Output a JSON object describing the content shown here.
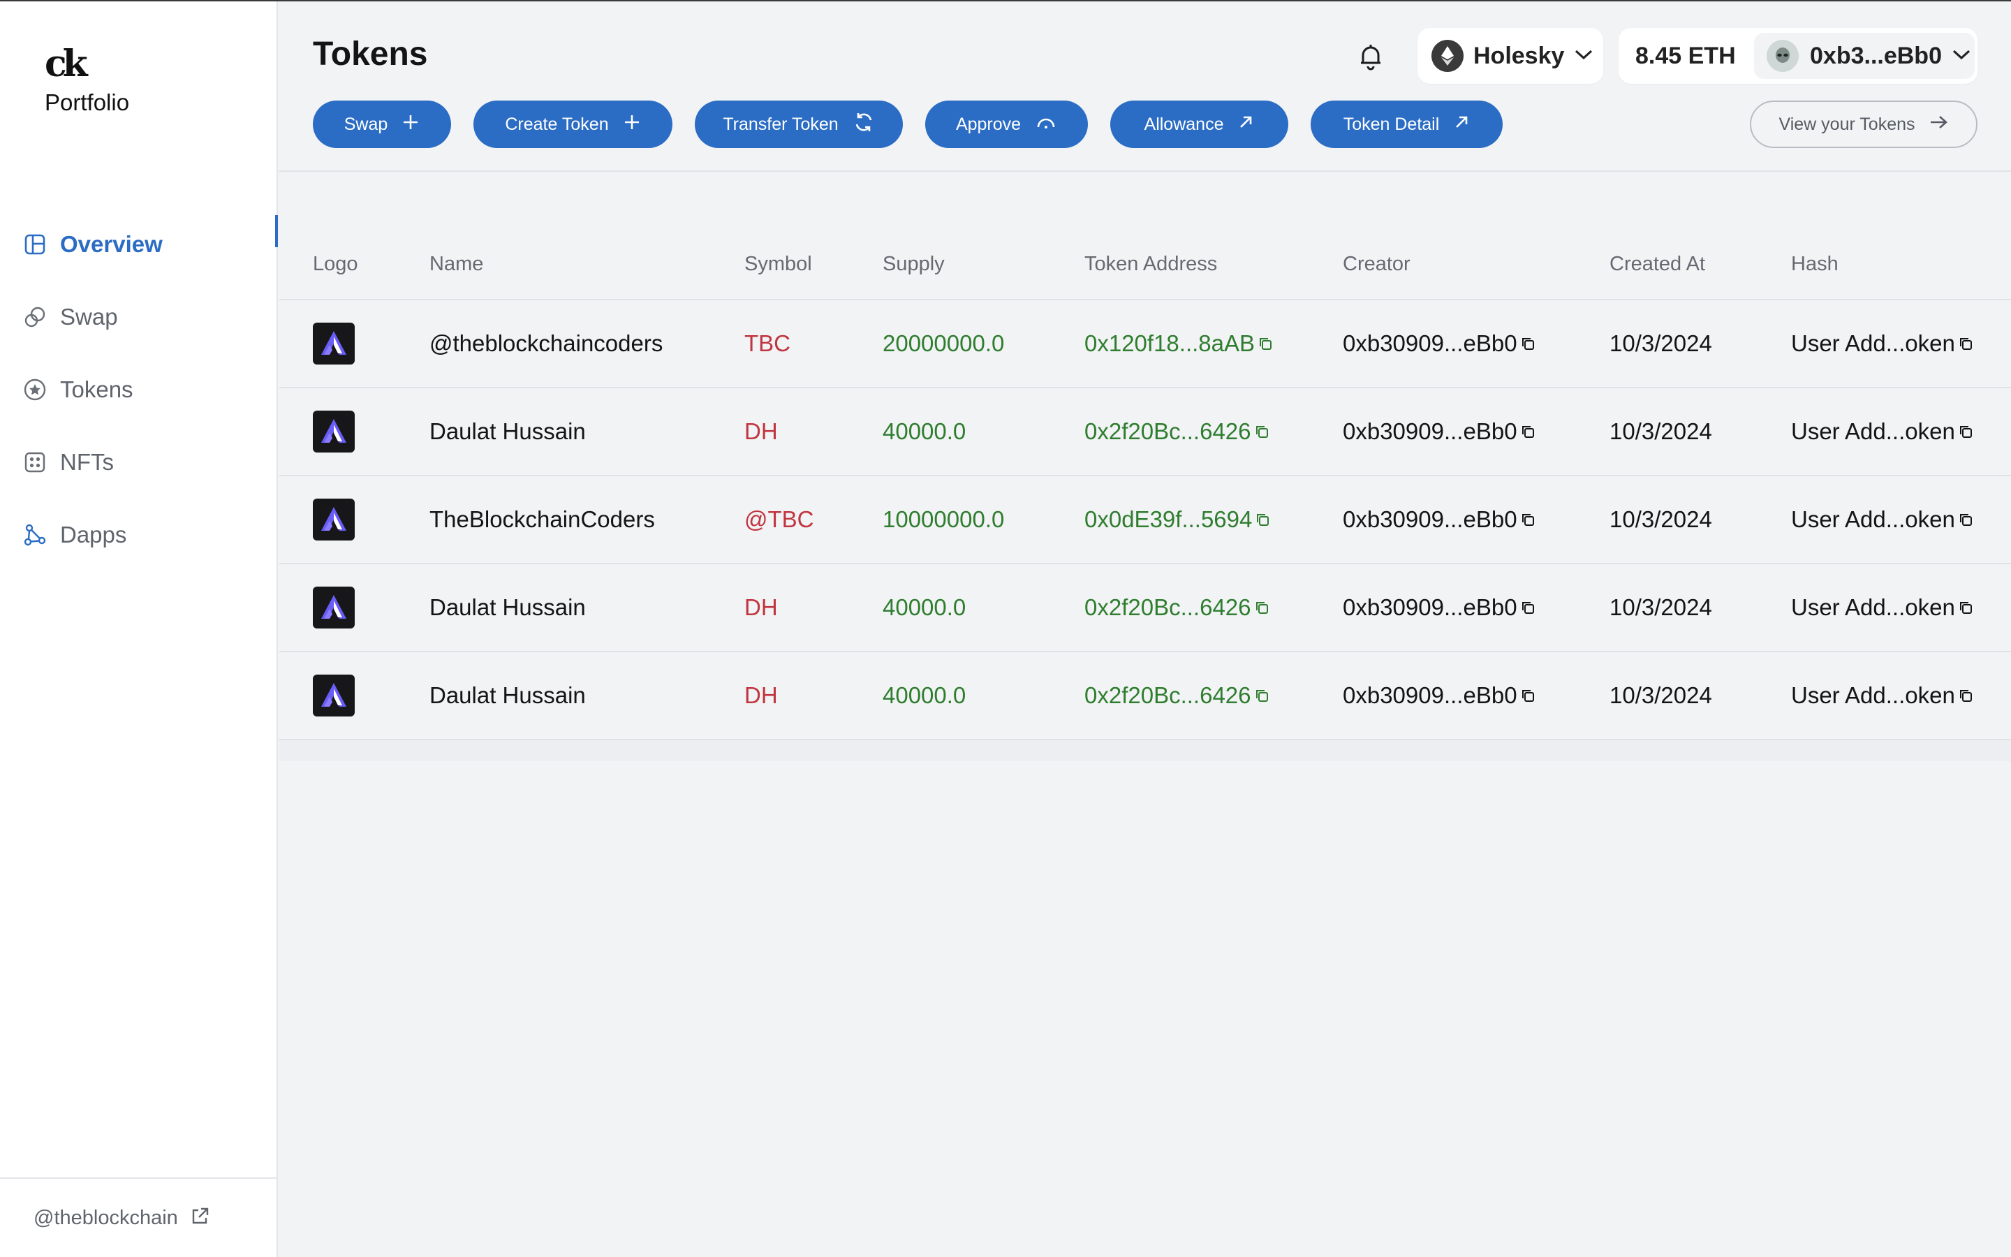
{
  "sidebar": {
    "brand_logo": "ck",
    "brand_name": "Portfolio",
    "items": [
      {
        "label": "Overview",
        "icon": "layout-icon",
        "active": true
      },
      {
        "label": "Swap",
        "icon": "swap-coins-icon",
        "active": false
      },
      {
        "label": "Tokens",
        "icon": "token-star-icon",
        "active": false
      },
      {
        "label": "NFTs",
        "icon": "grid-dots-icon",
        "active": false
      },
      {
        "label": "Dapps",
        "icon": "network-nodes-icon",
        "active": false
      }
    ],
    "footer_handle": "@theblockchain"
  },
  "header": {
    "title": "Tokens",
    "network": "Holesky",
    "balance": "8.45 ETH",
    "account": "0xb3...eBb0"
  },
  "actions": [
    {
      "label": "Swap",
      "icon": "plus-icon"
    },
    {
      "label": "Create Token",
      "icon": "plus-icon"
    },
    {
      "label": "Transfer Token",
      "icon": "refresh-icon"
    },
    {
      "label": "Approve",
      "icon": "arc-icon"
    },
    {
      "label": "Allowance",
      "icon": "arrow-up-right-icon"
    },
    {
      "label": "Token Detail",
      "icon": "arrow-up-right-icon"
    }
  ],
  "view_tokens": "View your Tokens",
  "table": {
    "columns": [
      "Logo",
      "Name",
      "Symbol",
      "Supply",
      "Token Address",
      "Creator",
      "Created At",
      "Hash"
    ],
    "rows": [
      {
        "name": "@theblockchaincoders",
        "symbol": "TBC",
        "supply": "20000000.0",
        "address": "0x120f18...8aAB",
        "creator": "0xb30909...eBb0",
        "created": "10/3/2024",
        "hash": "User Add...oken"
      },
      {
        "name": "Daulat Hussain",
        "symbol": "DH",
        "supply": "40000.0",
        "address": "0x2f20Bc...6426",
        "creator": "0xb30909...eBb0",
        "created": "10/3/2024",
        "hash": "User Add...oken"
      },
      {
        "name": "TheBlockchainCoders",
        "symbol": "@TBC",
        "supply": "10000000.0",
        "address": "0x0dE39f...5694",
        "creator": "0xb30909...eBb0",
        "created": "10/3/2024",
        "hash": "User Add...oken"
      },
      {
        "name": "Daulat Hussain",
        "symbol": "DH",
        "supply": "40000.0",
        "address": "0x2f20Bc...6426",
        "creator": "0xb30909...eBb0",
        "created": "10/3/2024",
        "hash": "User Add...oken"
      },
      {
        "name": "Daulat Hussain",
        "symbol": "DH",
        "supply": "40000.0",
        "address": "0x2f20Bc...6426",
        "creator": "0xb30909...eBb0",
        "created": "10/3/2024",
        "hash": "User Add...oken"
      }
    ]
  },
  "colors": {
    "accent": "#2b6cc4",
    "symbol": "#c0353f",
    "supply": "#2f7d2f",
    "background": "#f2f3f5"
  }
}
